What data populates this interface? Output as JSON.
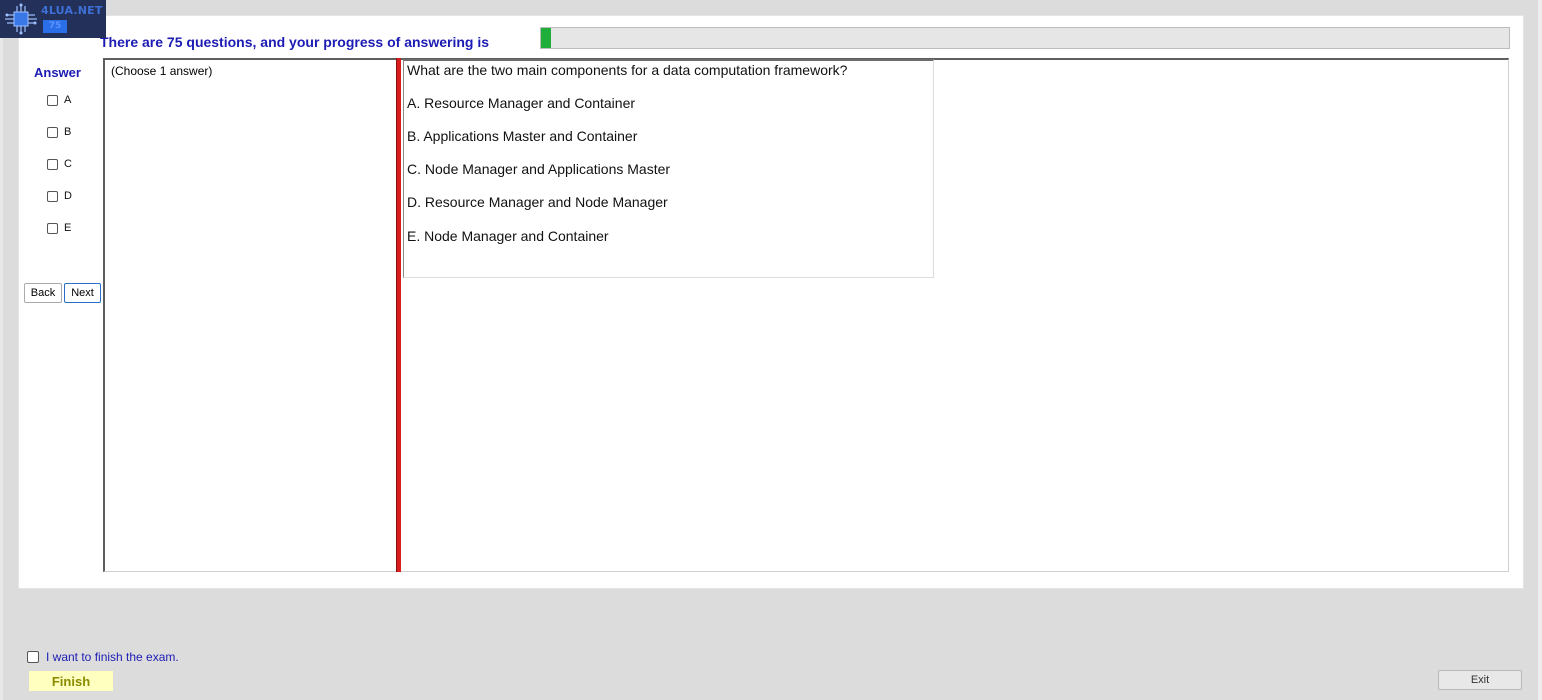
{
  "logo": {
    "text": "4LUA.NET",
    "badge": "75"
  },
  "progress": {
    "label": "There are 75 questions, and your progress of answering is",
    "value_percent": 1
  },
  "answer_panel": {
    "heading": "Answer",
    "options": [
      "A",
      "B",
      "C",
      "D",
      "E"
    ],
    "back_label": "Back",
    "next_label": "Next"
  },
  "instruction": "(Choose 1 answer)",
  "question": {
    "text": "What are the two main components for a data computation framework?",
    "choices": [
      "A.  Resource Manager and Container",
      "B.  Applications Master and Container",
      "C.  Node Manager and Applications Master",
      "D.  Resource Manager and Node Manager",
      "E.  Node Manager and Container"
    ]
  },
  "footer": {
    "finish_check_label": "I want to finish the exam.",
    "finish_label": "Finish",
    "exit_label": "Exit"
  },
  "colors": {
    "accent_text": "#1c1cb4",
    "progress_fill": "#1fae3a",
    "divider_red": "#d71d1d",
    "finish_bg": "#ffffc0"
  }
}
